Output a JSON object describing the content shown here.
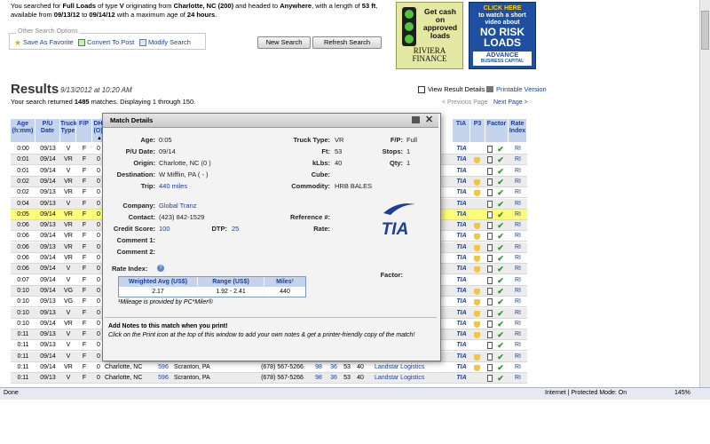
{
  "summary": {
    "p1": "You searched for ",
    "load_type": "Full Loads",
    "p2": " of type ",
    "equip": "V",
    "p3": " originating from ",
    "origin": "Charlotte, NC (200)",
    "p4": " and headed to ",
    "dest": "Anywhere",
    "p5": ", with a length of ",
    "length": "53 ft",
    "p6": ",",
    "p7": "available from ",
    "from": "09/13/12",
    "p8": " to ",
    "to": "09/14/12",
    "p9": " with a maximum age of ",
    "age": "24 hours",
    "p10": "."
  },
  "options": {
    "legend": "Other Search Options",
    "save": "Save As Favorite",
    "convert": "Convert To Post",
    "modify": "Modify Search"
  },
  "buttons": {
    "new_search": "New Search",
    "refresh": "Refresh Search"
  },
  "ads": {
    "ad1_line1": "Get cash",
    "ad1_line2": "on",
    "ad1_line3": "approved",
    "ad1_line4": "loads",
    "ad1_brand": "RIVIERA",
    "ad1_brand2": "FINANCE",
    "ad2_line1": "CLICK HERE",
    "ad2_line2": "to watch a short",
    "ad2_line3": "video about",
    "ad2_big1": "NO RISK",
    "ad2_big2": "LOADS",
    "ad2_brand": "ADVANCE",
    "ad2_brand2": "BUSINESS CAPITAL"
  },
  "results": {
    "title": "Results",
    "date": "9/13/2012 at 10:20 AM",
    "line_pre": "Your search returned ",
    "count": "1485",
    "line_post": " matches. Displaying 1 through 150.",
    "view_details": "View Result Details",
    "printable": "Printable Version",
    "prev": "< Previous Page",
    "next": "Next Page >"
  },
  "table": {
    "headers": [
      "Age (h:mm)",
      "P/U Date",
      "Truck Type",
      "F/P",
      "DH (O)",
      "TIA",
      "P3",
      "Factor",
      "Rate Index"
    ],
    "rows": [
      {
        "age": "0:00",
        "date": "09/13",
        "type": "V",
        "fp": "F",
        "dh": "0",
        "tia": true,
        "p3": false,
        "rate": "RI"
      },
      {
        "age": "0:01",
        "date": "09/14",
        "type": "VR",
        "fp": "F",
        "dh": "0",
        "tia": true,
        "p3": true,
        "rate": "RI"
      },
      {
        "age": "0:01",
        "date": "09/14",
        "type": "V",
        "fp": "F",
        "dh": "0",
        "tia": true,
        "p3": false,
        "rate": "RI"
      },
      {
        "age": "0:02",
        "date": "09/14",
        "type": "VR",
        "fp": "F",
        "dh": "0",
        "tia": true,
        "p3": true,
        "rate": "RI"
      },
      {
        "age": "0:02",
        "date": "09/13",
        "type": "VR",
        "fp": "F",
        "dh": "0",
        "tia": true,
        "p3": true,
        "rate": "RI"
      },
      {
        "age": "0:04",
        "date": "09/13",
        "type": "V",
        "fp": "F",
        "dh": "0",
        "tia": true,
        "p3": false,
        "rate": "RI"
      },
      {
        "age": "0:05",
        "date": "09/14",
        "type": "VR",
        "fp": "F",
        "dh": "0",
        "tia": true,
        "p3": false,
        "rate": "RI",
        "hl": true
      },
      {
        "age": "0:06",
        "date": "09/13",
        "type": "VR",
        "fp": "F",
        "dh": "0",
        "tia": true,
        "p3": true,
        "rate": "RI"
      },
      {
        "age": "0:06",
        "date": "09/14",
        "type": "VR",
        "fp": "F",
        "dh": "0",
        "tia": true,
        "p3": true,
        "rate": "RI"
      },
      {
        "age": "0:06",
        "date": "09/13",
        "type": "VR",
        "fp": "F",
        "dh": "0",
        "tia": true,
        "p3": true,
        "rate": "RI"
      },
      {
        "age": "0:06",
        "date": "09/14",
        "type": "VR",
        "fp": "F",
        "dh": "0",
        "tia": true,
        "p3": true,
        "rate": "RI"
      },
      {
        "age": "0:06",
        "date": "09/14",
        "type": "V",
        "fp": "F",
        "dh": "0",
        "tia": true,
        "p3": true,
        "rate": "RI"
      },
      {
        "age": "0:07",
        "date": "09/14",
        "type": "V",
        "fp": "F",
        "dh": "0",
        "tia": true,
        "p3": false,
        "rate": "RI"
      },
      {
        "age": "0:10",
        "date": "09/14",
        "type": "VG",
        "fp": "F",
        "dh": "0",
        "tia": true,
        "p3": true,
        "rate": "RI"
      },
      {
        "age": "0:10",
        "date": "09/13",
        "type": "VG",
        "fp": "F",
        "dh": "0",
        "tia": true,
        "p3": true,
        "rate": "RI"
      },
      {
        "age": "0:10",
        "date": "09/13",
        "type": "V",
        "fp": "F",
        "dh": "0",
        "tia": true,
        "p3": true,
        "rate": "RI"
      },
      {
        "age": "0:10",
        "date": "09/14",
        "type": "VR",
        "fp": "F",
        "dh": "0",
        "tia": true,
        "p3": true,
        "rate": "RI"
      },
      {
        "age": "0:11",
        "date": "09/13",
        "type": "V",
        "fp": "F",
        "dh": "0",
        "tia": true,
        "p3": true,
        "rate": "RI"
      },
      {
        "age": "0:11",
        "date": "09/13",
        "type": "V",
        "fp": "F",
        "dh": "0",
        "tia": true,
        "p3": false,
        "rate": "RI"
      },
      {
        "age": "0:11",
        "date": "09/14",
        "type": "V",
        "fp": "F",
        "dh": "0",
        "tia": true,
        "p3": true,
        "rate": "RI"
      },
      {
        "age": "0:11",
        "date": "09/14",
        "type": "VR",
        "fp": "F",
        "dh": "0",
        "tia": true,
        "p3": true,
        "rate": "RI"
      },
      {
        "age": "0:11",
        "date": "09/13",
        "type": "V",
        "fp": "F",
        "dh": "0",
        "tia": true,
        "p3": false,
        "rate": "RI"
      }
    ],
    "bottom_rows": [
      {
        "origin": "Charlotte, NC",
        "dist": "596",
        "dest": "Scranton, PA",
        "phone": "(678) 567-5266",
        "len": "98",
        "ft": "36",
        "kl": "53",
        "num": "40",
        "company": "Landstar Logistics"
      },
      {
        "origin": "Charlotte, NC",
        "dist": "596",
        "dest": "Scranton, PA",
        "phone": "(678) 567-5266",
        "len": "98",
        "ft": "36",
        "kl": "53",
        "num": "40",
        "company": "Landstar Logistics"
      }
    ]
  },
  "modal": {
    "title": "Match Details",
    "age_l": "Age:",
    "age_v": "0:05",
    "pu_l": "P/U Date:",
    "pu_v": "09/14",
    "origin_l": "Origin:",
    "origin_v": "Charlotte, NC (0 )",
    "dest_l": "Destination:",
    "dest_v": "W Mifflin, PA ( - )",
    "trip_l": "Trip:",
    "trip_v": "440 miles",
    "truck_l": "Truck Type:",
    "truck_v": "VR",
    "ft_l": "Ft:",
    "ft_v": "53",
    "klbs_l": "kLbs:",
    "klbs_v": "40",
    "cube_l": "Cube:",
    "cube_v": "",
    "commodity_l": "Commodity:",
    "commodity_v": "HRB BALES",
    "fp_l": "F/P:",
    "fp_v": "Full",
    "stops_l": "Stops:",
    "stops_v": "1",
    "qty_l": "Qty:",
    "qty_v": "1",
    "company_l": "Company:",
    "company_v": "Global Tranz",
    "contact_l": "Contact:",
    "contact_v": "(423) 842-1529",
    "credit_l": "Credit Score:",
    "credit_v": "100",
    "dtp_l": "DTP:",
    "dtp_v": "25",
    "c1_l": "Comment 1:",
    "c2_l": "Comment 2:",
    "ref_l": "Reference #:",
    "rate_l": "Rate:",
    "factor_l": "Factor:",
    "rate_index_l": "Rate Index:",
    "rt_h1": "Weighted Avg (US$)",
    "rt_h2": "Range (US$)",
    "rt_h3": "Miles¹",
    "rt_v1": "2.17",
    "rt_v2": "1.92 - 2.41",
    "rt_v3": "440",
    "mileage_note": "¹Mileage is provided by PC*Miler®",
    "notes_title": "Add Notes to this match when you print!",
    "notes_body": "Click on the Print icon at the top of this window to add your own notes & get a printer-friendly copy of the match!",
    "logo": "TIA"
  },
  "status": {
    "done": "Done",
    "zone": "Internet | Protected Mode: On",
    "zoom": "145%"
  },
  "colors": {
    "header_bg": "#c5d4ec",
    "row_odd": "#ececec",
    "highlight": "#fdfd7a",
    "link": "#1a3f9a",
    "check": "#2a9a2a"
  }
}
